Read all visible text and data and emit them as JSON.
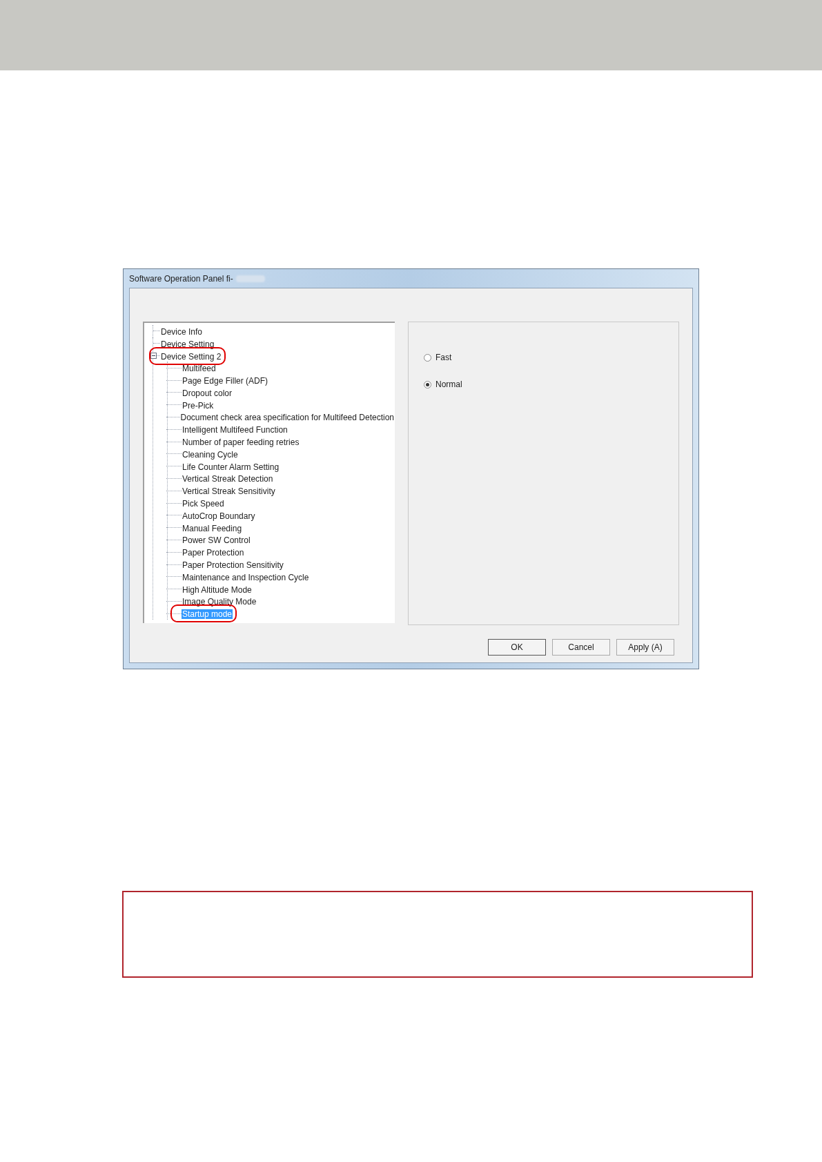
{
  "window": {
    "title": "Software Operation Panel fi-"
  },
  "tree": [
    {
      "label": "Device Info",
      "selected": false,
      "circled": false
    },
    {
      "label": "Device Setting",
      "selected": false,
      "circled": false
    },
    {
      "label": "Device Setting 2",
      "selected": false,
      "circled": true,
      "expanded": true,
      "children": [
        {
          "label": "Multifeed",
          "selected": false,
          "circled": false
        },
        {
          "label": "Page Edge Filler (ADF)",
          "selected": false,
          "circled": false
        },
        {
          "label": "Dropout color",
          "selected": false,
          "circled": false
        },
        {
          "label": "Pre-Pick",
          "selected": false,
          "circled": false
        },
        {
          "label": "Document check area specification for Multifeed Detection",
          "selected": false,
          "circled": false
        },
        {
          "label": "Intelligent Multifeed Function",
          "selected": false,
          "circled": false
        },
        {
          "label": "Number of paper feeding retries",
          "selected": false,
          "circled": false
        },
        {
          "label": "Cleaning Cycle",
          "selected": false,
          "circled": false
        },
        {
          "label": "Life Counter Alarm Setting",
          "selected": false,
          "circled": false
        },
        {
          "label": "Vertical Streak Detection",
          "selected": false,
          "circled": false
        },
        {
          "label": "Vertical Streak Sensitivity",
          "selected": false,
          "circled": false
        },
        {
          "label": "Pick Speed",
          "selected": false,
          "circled": false
        },
        {
          "label": "AutoCrop Boundary",
          "selected": false,
          "circled": false
        },
        {
          "label": "Manual Feeding",
          "selected": false,
          "circled": false
        },
        {
          "label": "Power SW Control",
          "selected": false,
          "circled": false
        },
        {
          "label": "Paper Protection",
          "selected": false,
          "circled": false
        },
        {
          "label": "Paper Protection Sensitivity",
          "selected": false,
          "circled": false
        },
        {
          "label": "Maintenance and Inspection Cycle",
          "selected": false,
          "circled": false
        },
        {
          "label": "High Altitude Mode",
          "selected": false,
          "circled": false
        },
        {
          "label": "Image Quality Mode",
          "selected": false,
          "circled": false
        },
        {
          "label": "Startup mode",
          "selected": true,
          "circled": true
        }
      ]
    }
  ],
  "options": [
    {
      "label": "Fast",
      "selected": false
    },
    {
      "label": "Normal",
      "selected": true
    }
  ],
  "buttons": [
    "OK",
    "Cancel",
    "Apply (A)"
  ]
}
